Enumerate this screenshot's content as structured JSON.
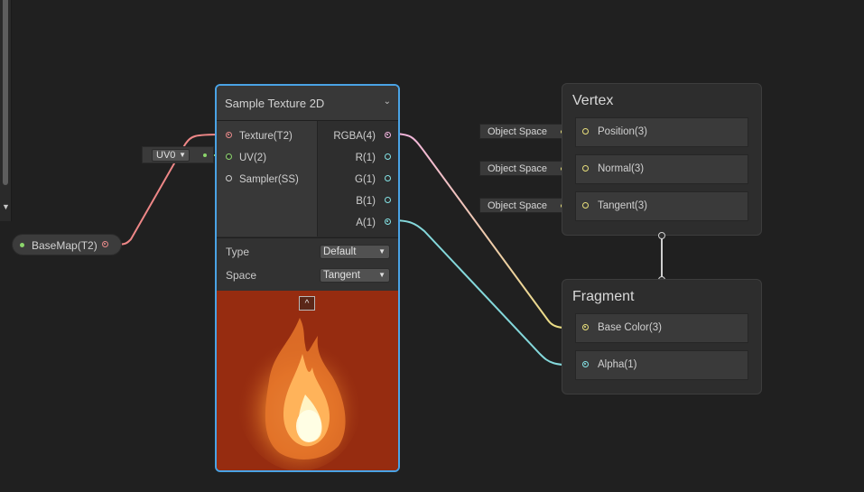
{
  "left_panel": {
    "collapse_arrow": "▼"
  },
  "property_node": {
    "label": "BaseMap(T2)"
  },
  "uv_input": {
    "value": "UV0"
  },
  "sample_texture": {
    "title": "Sample Texture 2D",
    "collapse_icon": "⌄",
    "inputs": [
      "Texture(T2)",
      "UV(2)",
      "Sampler(SS)"
    ],
    "outputs": [
      "RGBA(4)",
      "R(1)",
      "G(1)",
      "B(1)",
      "A(1)"
    ],
    "settings": {
      "type_label": "Type",
      "type_value": "Default",
      "space_label": "Space",
      "space_value": "Tangent"
    },
    "preview_toggle": "^"
  },
  "vertex": {
    "title": "Vertex",
    "blocks": [
      "Position(3)",
      "Normal(3)",
      "Tangent(3)"
    ],
    "space_inputs": [
      "Object Space",
      "Object Space",
      "Object Space"
    ]
  },
  "fragment": {
    "title": "Fragment",
    "blocks": [
      "Base Color(3)",
      "Alpha(1)"
    ]
  },
  "colors": {
    "texture_port": "#e98a8a",
    "vector2_port": "#8bd56b",
    "vector4_port": "#f3b4df",
    "float_port": "#84e4e7",
    "vector3_port": "#e9e07c",
    "selection": "#4aa3e5"
  }
}
